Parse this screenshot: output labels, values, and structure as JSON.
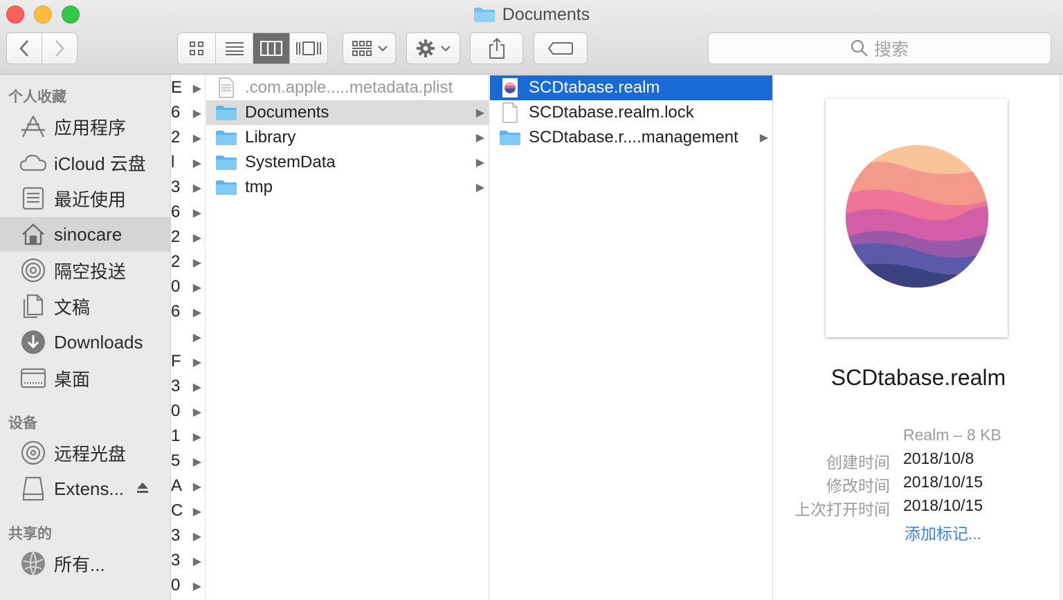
{
  "window": {
    "title": "Documents"
  },
  "toolbar": {
    "search_placeholder": "搜索"
  },
  "sidebar": {
    "favorites_header": "个人收藏",
    "favorites": [
      {
        "label": "应用程序",
        "icon": "applications-icon"
      },
      {
        "label": "iCloud 云盘",
        "icon": "cloud-icon"
      },
      {
        "label": "最近使用",
        "icon": "recents-icon"
      },
      {
        "label": "sinocare",
        "icon": "home-icon",
        "selected": true
      },
      {
        "label": "隔空投送",
        "icon": "airdrop-icon"
      },
      {
        "label": "文稿",
        "icon": "documents-icon"
      },
      {
        "label": "Downloads",
        "icon": "downloads-icon"
      },
      {
        "label": "桌面",
        "icon": "desktop-icon"
      }
    ],
    "devices_header": "设备",
    "devices": [
      {
        "label": "远程光盘",
        "icon": "disc-icon"
      },
      {
        "label": "Extens...",
        "icon": "drive-icon",
        "eject": true
      }
    ],
    "shared_header": "共享的",
    "shared": [
      {
        "label": "所有...",
        "icon": "network-icon"
      }
    ]
  },
  "column0": {
    "chars": [
      "E",
      "6",
      "2",
      "l",
      "3",
      "6",
      "2",
      "2",
      "0",
      "6",
      "",
      "F",
      "3",
      "0",
      "1",
      "5",
      "A",
      "C",
      "3",
      "3",
      "0"
    ]
  },
  "column1": {
    "items": [
      {
        "name": ".com.apple.....metadata.plist",
        "type": "plist",
        "dim": true,
        "arrow": false
      },
      {
        "name": "Documents",
        "type": "folder",
        "arrow": true,
        "highlight": true
      },
      {
        "name": "Library",
        "type": "folder",
        "arrow": true
      },
      {
        "name": "SystemData",
        "type": "folder",
        "arrow": true
      },
      {
        "name": "tmp",
        "type": "folder",
        "arrow": true
      }
    ]
  },
  "column2": {
    "items": [
      {
        "name": "SCDtabase.realm",
        "type": "realm",
        "selected": true,
        "arrow": false
      },
      {
        "name": "SCDtabase.realm.lock",
        "type": "file",
        "arrow": false
      },
      {
        "name": "SCDtabase.r....management",
        "type": "folder",
        "arrow": true
      }
    ]
  },
  "preview": {
    "file_name": "SCDtabase.realm",
    "kind_size": "Realm – 8 KB",
    "created_label": "创建时间",
    "created_value": "2018/10/8",
    "modified_label": "修改时间",
    "modified_value": "2018/10/15",
    "opened_label": "上次打开时间",
    "opened_value": "2018/10/15",
    "add_tags": "添加标记..."
  },
  "colors": {
    "selection": "#1a6ad6",
    "folder": "#6ec0f3",
    "link": "#3a83e4"
  }
}
